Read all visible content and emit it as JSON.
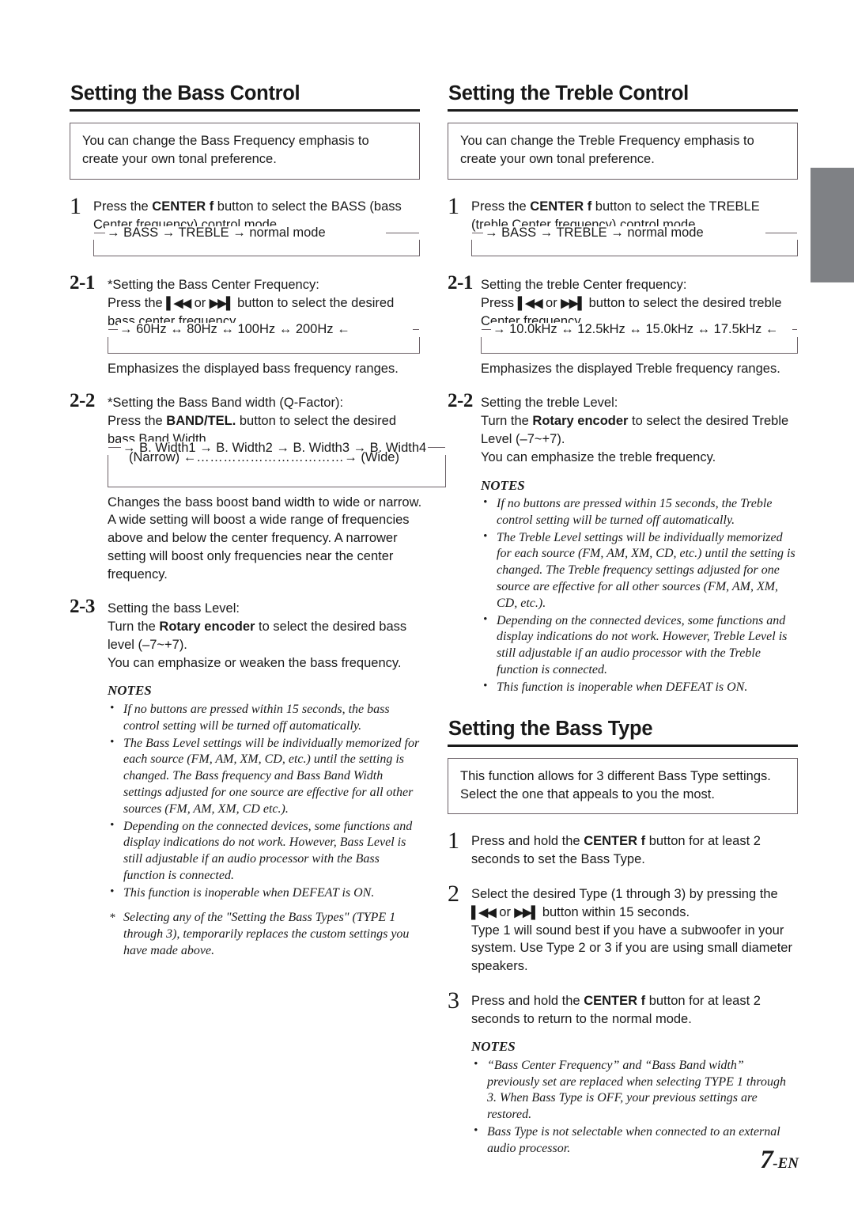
{
  "page": {
    "number": "7",
    "suffix": "-EN",
    "edge_tab_color": "#7f8185"
  },
  "left_column": {
    "section": {
      "heading": "Setting the Bass Control",
      "intro": {
        "line1": "You can change the Bass Frequency emphasis to",
        "line2": "create your own tonal preference."
      },
      "step1": {
        "num": "1",
        "line1_a": "Press the ",
        "line1_b": "CENTER f",
        "line1_c": " button to select the BASS (bass",
        "line2": "Center frequency) control mode.",
        "cycle": {
          "arrow_in": "→",
          "items": [
            "BASS",
            "TREBLE",
            "normal mode"
          ],
          "separator": "→",
          "text": "→ BASS → TREBLE → normal mode"
        }
      },
      "step2_1": {
        "num": "2-1",
        "title": "*Setting the Bass Center Frequency:",
        "line1_a": "Press the ",
        "line1_glyph1": "▌◀◀",
        "line1_b": " or ",
        "line1_glyph2": "▶▶▌",
        "line1_c": " button to select the desired",
        "line2": "bass center frequency.",
        "cycle": {
          "items": [
            "60Hz",
            "80Hz",
            "100Hz",
            "200Hz"
          ],
          "separator": "↔",
          "text": "→   60Hz  ↔  80Hz  ↔  100Hz  ↔  200Hz  ←"
        },
        "caption": "Emphasizes the displayed bass frequency ranges."
      },
      "step2_2": {
        "num": "2-2",
        "title": "*Setting the Bass Band width (Q-Factor):",
        "line1_a": "Press the ",
        "line1_b": "BAND/TEL.",
        "line1_c": " button to select the desired",
        "line2": "bass Band Width.",
        "cycle": {
          "items": [
            "B. Width1",
            "B. Width2",
            "B. Width3",
            "B. Width4"
          ],
          "separator": "→",
          "text": "→ B. Width1 → B. Width2 → B. Width3 → B. Width4",
          "line2_left": "(Narrow)",
          "line2_arrow_left": "←",
          "line2_dots": "……………………………",
          "line2_arrow_right": "→",
          "line2_right": "(Wide)"
        },
        "description": {
          "line1": "Changes the bass boost band width to wide or narrow.",
          "line2": "A wide setting will boost a wide range of frequencies",
          "line3": "above and below the center frequency. A narrower",
          "line4": "setting will boost only frequencies near the center",
          "line5": "frequency."
        }
      },
      "step2_3": {
        "num": "2-3",
        "title": "Setting the bass Level:",
        "line1_a": "Turn the ",
        "line1_b": "Rotary encoder",
        "line1_c": " to select the desired bass",
        "line2": "level (–7~+7).",
        "line3": "You can emphasize or weaken the bass frequency."
      },
      "notes": {
        "title": "NOTES",
        "items": [
          "If no buttons are pressed within 15 seconds, the bass control setting will be turned off automatically.",
          "The Bass Level settings will be individually memorized for each source (FM, AM, XM, CD, etc.) until the setting is changed. The Bass frequency and Bass Band Width settings adjusted for one source are effective for all other sources (FM, AM, XM, CD etc.).",
          "Depending on the connected devices, some functions and display indications do not work. However, Bass Level is still adjustable if an audio processor with the Bass function is connected.",
          "This function is inoperable when DEFEAT is ON."
        ],
        "star_item": "Selecting any of the \"Setting the Bass Types\" (TYPE 1 through 3), temporarily replaces the custom settings you have made above."
      }
    }
  },
  "right_column": {
    "treble_section": {
      "heading": "Setting the Treble Control",
      "intro": {
        "line1": "You can change the Treble Frequency emphasis to",
        "line2": "create your own tonal preference."
      },
      "step1": {
        "num": "1",
        "line1_a": "Press the ",
        "line1_b": "CENTER f",
        "line1_c": " button to select the TREBLE",
        "line2": "(treble Center frequency) control mode.",
        "cycle": {
          "items": [
            "BASS",
            "TREBLE",
            "normal mode"
          ],
          "separator": "→",
          "text": "→ BASS → TREBLE → normal mode"
        }
      },
      "step2_1": {
        "num": "2-1",
        "title": "Setting the treble Center frequency:",
        "line1_a": "Press ",
        "line1_glyph1": "▌◀◀",
        "line1_b": " or ",
        "line1_glyph2": "▶▶▌",
        "line1_c": " button to select the desired treble",
        "line2": "Center frequency.",
        "cycle": {
          "items": [
            "10.0kHz",
            "12.5kHz",
            "15.0kHz",
            "17.5kHz"
          ],
          "separator": "↔",
          "text": "→ 10.0kHz ↔ 12.5kHz ↔ 15.0kHz ↔ 17.5kHz ←"
        },
        "caption": "Emphasizes the displayed Treble frequency ranges."
      },
      "step2_2": {
        "num": "2-2",
        "title": "Setting the treble Level:",
        "line1_a": "Turn the ",
        "line1_b": "Rotary encoder",
        "line1_c": " to select the desired Treble",
        "line2": "Level (–7~+7).",
        "line3": "You can emphasize the treble frequency."
      },
      "notes": {
        "title": "NOTES",
        "items": [
          "If no buttons are pressed within 15 seconds, the Treble control setting will be turned off automatically.",
          "The Treble Level settings will be individually memorized for each source (FM, AM, XM, CD, etc.) until the setting is changed. The Treble frequency settings adjusted for one source are effective for all other sources (FM, AM, XM, CD, etc.).",
          "Depending on the connected devices, some functions and display indications do not work. However, Treble Level is still adjustable if an audio processor with the Treble function is connected.",
          "This function is inoperable when DEFEAT is ON."
        ]
      }
    },
    "bass_type_section": {
      "heading": "Setting the Bass Type",
      "intro": {
        "line1": "This function allows for 3 different Bass Type settings.",
        "line2": "Select the one that appeals to you the most."
      },
      "step1": {
        "num": "1",
        "line1_a": "Press and hold the ",
        "line1_b": "CENTER f",
        "line1_c": " button for at least 2",
        "line2": "seconds to set the Bass Type."
      },
      "step2": {
        "num": "2",
        "line1": "Select the desired Type (1 through 3) by pressing the",
        "line2_glyph1": "▌◀◀",
        "line2_a": " or  ",
        "line2_glyph2": "▶▶▌",
        "line2_b": " button within 15 seconds.",
        "line3": "Type 1 will sound best if you have a subwoofer in your",
        "line4": "system. Use Type 2 or 3 if you are using small diameter",
        "line5": "speakers."
      },
      "step3": {
        "num": "3",
        "line1_a": "Press and hold the ",
        "line1_b": "CENTER f",
        "line1_c": " button for at least 2",
        "line2": "seconds to return to the normal mode."
      },
      "notes": {
        "title": "NOTES",
        "items": [
          "“Bass Center Frequency” and “Bass Band width” previously set are replaced when selecting TYPE 1 through 3. When Bass Type is OFF, your previous settings are restored.",
          "Bass Type is not selectable when connected to an external audio processor."
        ]
      }
    }
  }
}
